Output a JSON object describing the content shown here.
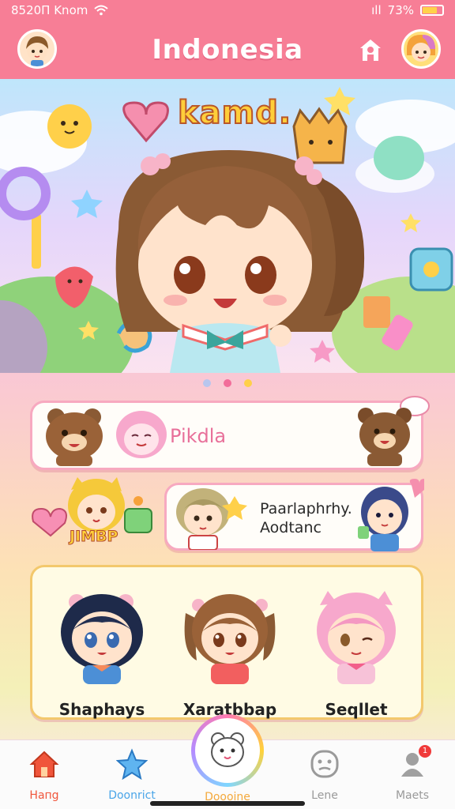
{
  "status": {
    "time": "8520Π Κnom",
    "signal": "ıll",
    "battery_text": "73%",
    "battery_level": 0.73
  },
  "header": {
    "title": "Indonesia"
  },
  "banner": {
    "logo_text": "kamd.",
    "page_count": 3,
    "active_page": 2,
    "dot_colors": [
      "#b8c6ee",
      "#f26d9a",
      "#ffd04a"
    ]
  },
  "cards": {
    "card1": {
      "label": "Pikdla"
    },
    "sticker_text": "JIMBP",
    "card2": {
      "line1": "Paarlaphrhy.",
      "line2": "Aodtanc"
    },
    "characters": [
      {
        "name": "Shaphays"
      },
      {
        "name": "Xaratbbap"
      },
      {
        "name": "Seqllet"
      }
    ]
  },
  "nav": {
    "items": [
      {
        "label": "Haпg",
        "icon": "home-icon",
        "color": "#f0553b"
      },
      {
        "label": "Doonrict",
        "icon": "star-icon",
        "color": "#4aa5e8"
      },
      {
        "label": "Doooine",
        "icon": "center-pet-icon",
        "color": "#f4a93c"
      },
      {
        "label": "Lene",
        "icon": "face-icon",
        "color": "#9a9a9a"
      },
      {
        "label": "Maets",
        "icon": "profile-icon",
        "color": "#9a9a9a"
      }
    ],
    "badge": "1"
  },
  "colors": {
    "brand": "#f77e96",
    "card_border": "#f7a9c0",
    "accent_yellow": "#ffce3a"
  }
}
